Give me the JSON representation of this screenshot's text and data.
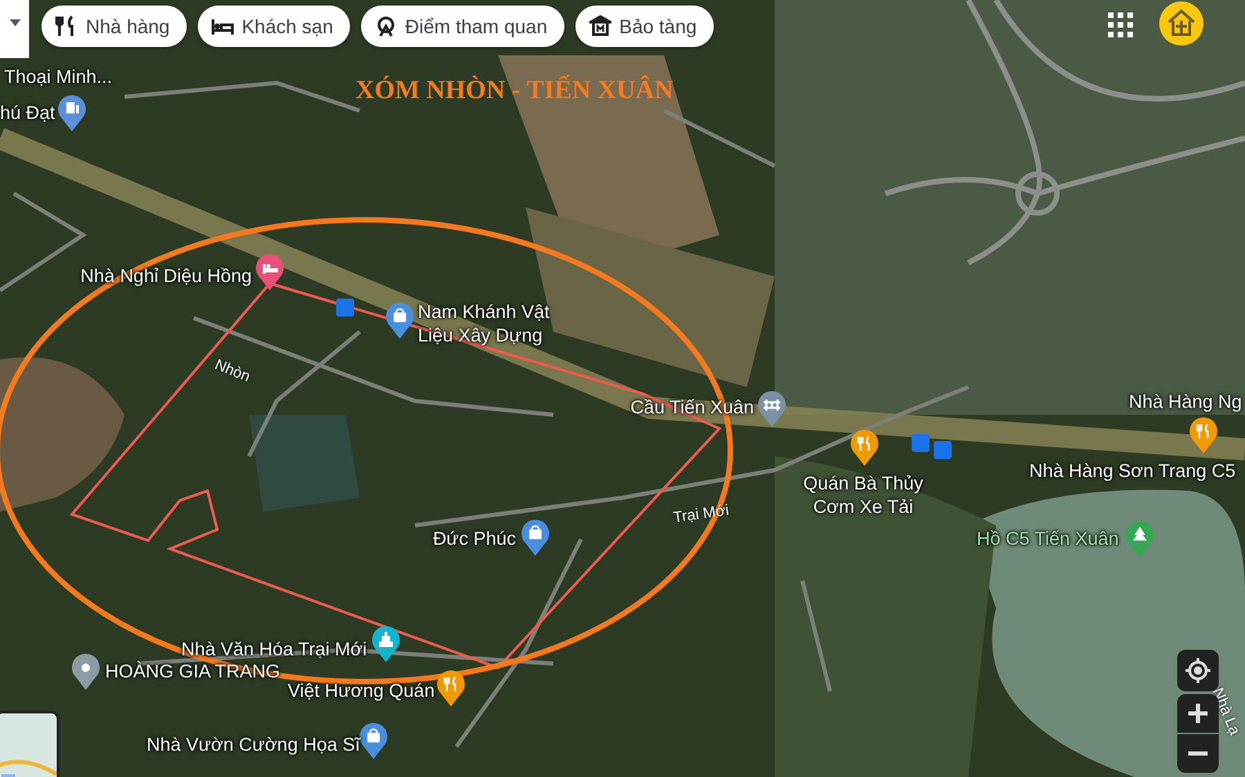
{
  "category_chips": [
    {
      "kind": "restaurant",
      "label": "Nhà hàng"
    },
    {
      "kind": "hotel",
      "label": "Khách sạn"
    },
    {
      "kind": "attraction",
      "label": "Điểm tham quan"
    },
    {
      "kind": "museum",
      "label": "Bảo tàng"
    }
  ],
  "overlay_title": "XÓM NHÒN - TIẾN XUÂN",
  "places": [
    {
      "label": "Thoại Minh...",
      "kind": "label"
    },
    {
      "label": "hú Đạt",
      "kind": "gas",
      "color": "#5b8fd8"
    },
    {
      "label": "Nhà Nghỉ Diệu Hồng",
      "kind": "lodging",
      "color": "#e8507a"
    },
    {
      "label": "Nam Khánh Vật Liệu Xây Dựng",
      "kind": "shop",
      "color": "#4a8ee0"
    },
    {
      "label": "Cầu Tiến Xuân",
      "kind": "bridge",
      "color": "#7b92a6"
    },
    {
      "label": "Quán Bà Thủy Cơm Xe Tải",
      "kind": "food",
      "color": "#f29900"
    },
    {
      "label": "Đức Phúc",
      "kind": "shop",
      "color": "#4a8ee0"
    },
    {
      "label": "Nhà Hàng Ng",
      "kind": "label"
    },
    {
      "label": "Nhà Hàng Sơn Trang C5",
      "kind": "food",
      "color": "#f29900"
    },
    {
      "label": "Hồ C5 Tiến Xuân",
      "kind": "park",
      "color": "#34a853"
    },
    {
      "label": "Nhà Văn Hóa Trại Mới",
      "kind": "civic",
      "color": "#12b5cb"
    },
    {
      "label": "HOÀNG GIA TRANG",
      "kind": "place",
      "color": "#8d9ba7"
    },
    {
      "label": "Việt Hương Quán",
      "kind": "food",
      "color": "#f29900"
    },
    {
      "label": "Nhà Vườn Cường Họa Sĩ",
      "kind": "shop",
      "color": "#4a8ee0"
    }
  ],
  "road_labels": [
    "Nhòn",
    "Trại Mới",
    "Nhà Lạ"
  ]
}
